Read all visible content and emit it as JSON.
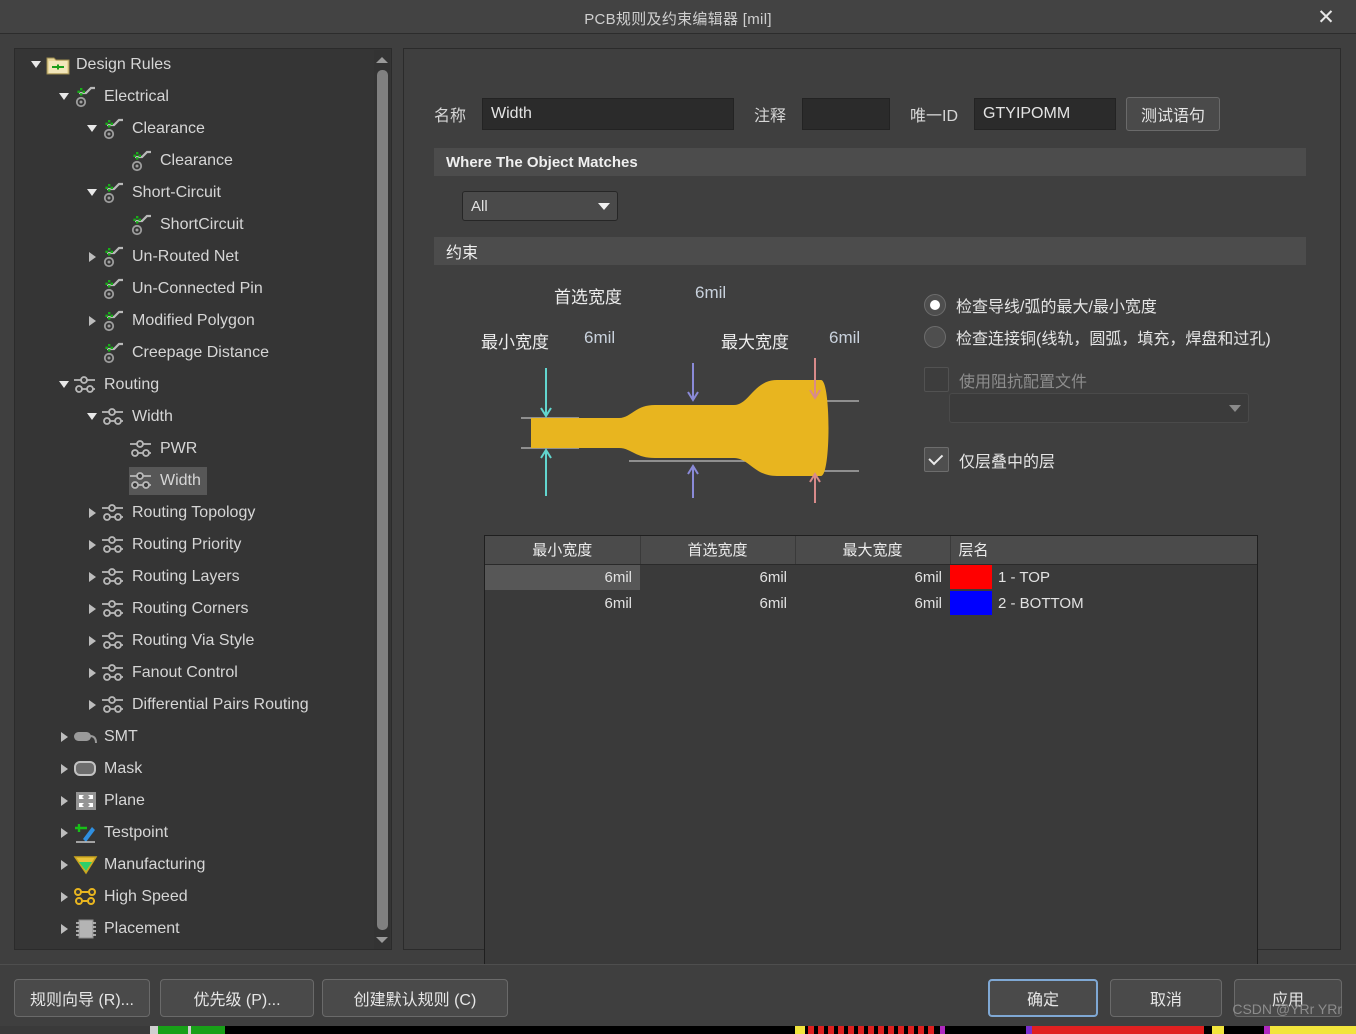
{
  "window": {
    "title": "PCB规则及约束编辑器 [mil]",
    "close_label": "✕"
  },
  "tree": {
    "items": [
      {
        "label": "Design Rules",
        "depth": 0,
        "twisty": "open",
        "icon": "design-rules-folder-icon"
      },
      {
        "label": "Electrical",
        "depth": 1,
        "twisty": "open",
        "icon": "electrical-rule-icon"
      },
      {
        "label": "Clearance",
        "depth": 2,
        "twisty": "open",
        "icon": "electrical-rule-icon"
      },
      {
        "label": "Clearance",
        "depth": 3,
        "twisty": "none",
        "icon": "electrical-rule-icon"
      },
      {
        "label": "Short-Circuit",
        "depth": 2,
        "twisty": "open",
        "icon": "electrical-rule-icon"
      },
      {
        "label": "ShortCircuit",
        "depth": 3,
        "twisty": "none",
        "icon": "electrical-rule-icon"
      },
      {
        "label": "Un-Routed Net",
        "depth": 2,
        "twisty": "closed",
        "icon": "electrical-rule-icon"
      },
      {
        "label": "Un-Connected Pin",
        "depth": 2,
        "twisty": "none",
        "icon": "electrical-rule-icon"
      },
      {
        "label": "Modified Polygon",
        "depth": 2,
        "twisty": "closed",
        "icon": "electrical-rule-icon"
      },
      {
        "label": "Creepage Distance",
        "depth": 2,
        "twisty": "none",
        "icon": "electrical-rule-icon"
      },
      {
        "label": "Routing",
        "depth": 1,
        "twisty": "open",
        "icon": "routing-rule-icon"
      },
      {
        "label": "Width",
        "depth": 2,
        "twisty": "open",
        "icon": "routing-rule-icon"
      },
      {
        "label": "PWR",
        "depth": 3,
        "twisty": "none",
        "icon": "routing-rule-icon"
      },
      {
        "label": "Width",
        "depth": 3,
        "twisty": "none",
        "icon": "routing-rule-icon",
        "selected": true
      },
      {
        "label": "Routing Topology",
        "depth": 2,
        "twisty": "closed",
        "icon": "routing-rule-icon"
      },
      {
        "label": "Routing Priority",
        "depth": 2,
        "twisty": "closed",
        "icon": "routing-rule-icon"
      },
      {
        "label": "Routing Layers",
        "depth": 2,
        "twisty": "closed",
        "icon": "routing-rule-icon"
      },
      {
        "label": "Routing Corners",
        "depth": 2,
        "twisty": "closed",
        "icon": "routing-rule-icon"
      },
      {
        "label": "Routing Via Style",
        "depth": 2,
        "twisty": "closed",
        "icon": "routing-rule-icon"
      },
      {
        "label": "Fanout Control",
        "depth": 2,
        "twisty": "closed",
        "icon": "routing-rule-icon"
      },
      {
        "label": "Differential Pairs Routing",
        "depth": 2,
        "twisty": "closed",
        "icon": "routing-rule-icon"
      },
      {
        "label": "SMT",
        "depth": 1,
        "twisty": "closed",
        "icon": "smt-icon"
      },
      {
        "label": "Mask",
        "depth": 1,
        "twisty": "closed",
        "icon": "mask-icon"
      },
      {
        "label": "Plane",
        "depth": 1,
        "twisty": "closed",
        "icon": "plane-icon"
      },
      {
        "label": "Testpoint",
        "depth": 1,
        "twisty": "closed",
        "icon": "testpoint-icon"
      },
      {
        "label": "Manufacturing",
        "depth": 1,
        "twisty": "closed",
        "icon": "manufacturing-icon"
      },
      {
        "label": "High Speed",
        "depth": 1,
        "twisty": "closed",
        "icon": "high-speed-icon"
      },
      {
        "label": "Placement",
        "depth": 1,
        "twisty": "closed",
        "icon": "placement-icon"
      }
    ]
  },
  "rule": {
    "name_label": "名称",
    "name_value": "Width",
    "comment_label": "注释",
    "comment_value": "",
    "unique_id_label": "唯一ID",
    "unique_id_value": "GTYIPOMM",
    "test_query_button": "测试语句"
  },
  "match": {
    "section_title": "Where The Object Matches",
    "scope_value": "All"
  },
  "constraints": {
    "section_title": "约束",
    "diagram": {
      "preferred_label": "首选宽度",
      "preferred_value": "6mil",
      "min_label": "最小宽度",
      "min_value": "6mil",
      "max_label": "最大宽度",
      "max_value": "6mil",
      "min_arrow_color": "#62d6cf",
      "preferred_arrow_color": "#8a8ad8",
      "max_arrow_color": "#d88a8a",
      "track_color": "#e8b51f"
    },
    "options": {
      "radio_track_arc": "检查导线/弧的最大/最小宽度",
      "radio_connected_copper": "检查连接铜(线轨，圆弧，填充，焊盘和过孔)",
      "selected_radio": 0,
      "impedance_checkbox_label": "使用阻抗配置文件",
      "impedance_checked": false,
      "impedance_profile_value": "",
      "layers_checkbox_label": "仅层叠中的层",
      "layers_checked": true
    },
    "table": {
      "headers": [
        "最小宽度",
        "首选宽度",
        "最大宽度",
        "层名"
      ],
      "rows": [
        {
          "min": "6mil",
          "preferred": "6mil",
          "max": "6mil",
          "layer": "1 - TOP",
          "color": "#ff0000"
        },
        {
          "min": "6mil",
          "preferred": "6mil",
          "max": "6mil",
          "layer": "2 - BOTTOM",
          "color": "#0000ff"
        }
      ]
    }
  },
  "footer": {
    "rule_wizard": "规则向导 (R)...",
    "priorities": "优先级 (P)...",
    "create_default_rules": "创建默认规则 (C)",
    "ok": "确定",
    "cancel": "取消",
    "apply": "应用",
    "watermark": "CSDN @YRr YRr"
  }
}
